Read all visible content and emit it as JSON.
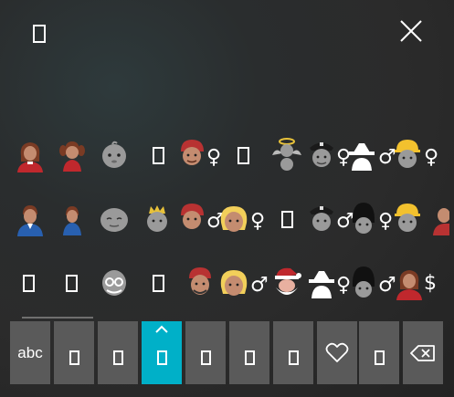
{
  "keyboard": {
    "abc_label": "abc"
  },
  "colors": {
    "accent": "#00b0c8",
    "key_background": "#5a5a5a",
    "panel_background": "#2b2b2b"
  },
  "icons": {
    "title": "unsupported-glyph",
    "close": "close-icon",
    "favorites": "heart-icon",
    "backspace": "backspace-icon"
  },
  "emoji_rows": [
    [
      "woman",
      "girl",
      "baby",
      "unsupported-glyph",
      "man-with-turban",
      "female-sign",
      "unsupported-glyph",
      "baby-angel",
      "police-officer",
      "female-sign",
      "detective",
      "male-sign",
      "construction-worker",
      "female-sign"
    ],
    [
      "man",
      "boy",
      "older-person",
      "princess",
      "man-with-turban",
      "male-sign",
      "person-with-blond-hair",
      "female-sign",
      "unsupported-glyph",
      "police-officer",
      "male-sign",
      "guardsman",
      "female-sign",
      "construction-worker"
    ],
    [
      "unsupported-glyph",
      "unsupported-glyph",
      "older-man-with-glasses",
      "unsupported-glyph",
      "man-with-cap",
      "person-with-blond-hair",
      "male-sign",
      "santa-claus",
      "detective",
      "female-sign",
      "guardsman",
      "male-sign",
      "woman-red",
      "dollar-sign"
    ]
  ],
  "categories": [
    {
      "name": "abc",
      "active": false
    },
    {
      "name": "unsupported-glyph",
      "active": false
    },
    {
      "name": "unsupported-glyph",
      "active": false
    },
    {
      "name": "unsupported-glyph",
      "active": true
    },
    {
      "name": "unsupported-glyph",
      "active": false
    },
    {
      "name": "unsupported-glyph",
      "active": false
    },
    {
      "name": "unsupported-glyph",
      "active": false
    },
    {
      "name": "heart-icon",
      "active": false
    },
    {
      "name": "unsupported-glyph",
      "active": false
    },
    {
      "name": "backspace-icon",
      "active": false
    }
  ]
}
